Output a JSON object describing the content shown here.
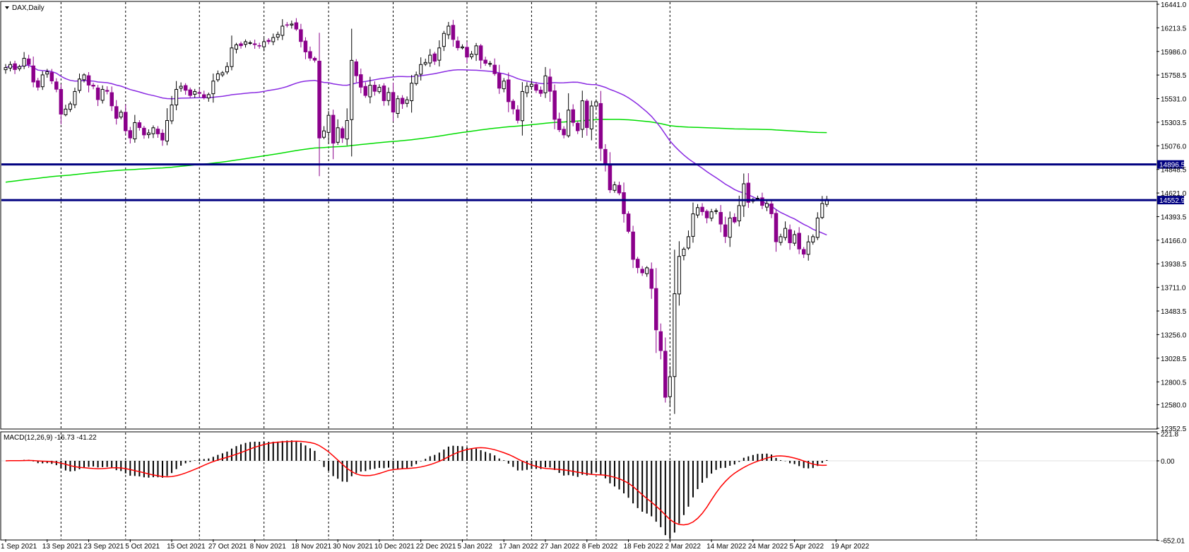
{
  "chart_title": "DAX,Daily",
  "chart_data": {
    "type": "candlestick",
    "symbol": "DAX",
    "timeframe": "Daily",
    "price_axis": {
      "ylim": [
        12352.5,
        16441.0
      ],
      "ticks": [
        "16441.0",
        "16213.5",
        "15986.0",
        "15758.5",
        "15531.0",
        "15303.5",
        "15076.0",
        "14848.5",
        "14621.0",
        "14393.5",
        "14166.0",
        "13938.5",
        "13711.0",
        "13483.5",
        "13256.0",
        "13028.5",
        "12800.5",
        "12580.0",
        "12352.5"
      ]
    },
    "x_axis": {
      "tick_labels": [
        "1 Sep 2021",
        "13 Sep 2021",
        "23 Sep 2021",
        "5 Oct 2021",
        "15 Oct 2021",
        "27 Oct 2021",
        "8 Nov 2021",
        "18 Nov 2021",
        "30 Nov 2021",
        "10 Dec 2021",
        "22 Dec 2021",
        "5 Jan 2022",
        "17 Jan 2022",
        "27 Jan 2022",
        "8 Feb 2022",
        "18 Feb 2022",
        "2 Mar 2022",
        "14 Mar 2022",
        "24 Mar 2022",
        "5 Apr 2022",
        "19 Apr 2022"
      ],
      "grid_at": [
        "13 Sep 2021",
        "5 Oct 2021",
        "27 Oct 2021",
        "18 Nov 2021",
        "10 Dec 2021",
        "5 Jan 2022",
        "27 Jan 2022",
        "18 Feb 2022",
        "14 Mar 2022",
        "5 Apr 2022"
      ]
    },
    "horizontal_levels": [
      {
        "price": 14896.5,
        "label": "14896.5",
        "color": "#000080"
      },
      {
        "price": 14552.9,
        "label": "14552.9",
        "color": "#000080"
      }
    ],
    "moving_averages": [
      {
        "role": "50-period",
        "color": "#8a2be2"
      },
      {
        "role": "200-period",
        "color": "#00dd00"
      }
    ],
    "close": [
      15830,
      15860,
      15810,
      15840,
      15920,
      15860,
      15690,
      15640,
      15760,
      15790,
      15700,
      15620,
      15380,
      15430,
      15480,
      15600,
      15720,
      15760,
      15660,
      15650,
      15520,
      15620,
      15600,
      15460,
      15340,
      15400,
      15220,
      15150,
      15300,
      15250,
      15180,
      15200,
      15250,
      15190,
      15130,
      15320,
      15470,
      15620,
      15650,
      15610,
      15560,
      15600,
      15580,
      15540,
      15570,
      15700,
      15770,
      15780,
      15840,
      16020,
      16050,
      16040,
      16080,
      16070,
      16050,
      16040,
      16080,
      16080,
      16120,
      16150,
      16230,
      16240,
      16250,
      16200,
      16080,
      15980,
      15920,
      15900,
      15150,
      15220,
      15370,
      15100,
      15250,
      15150,
      15320,
      15900,
      15750,
      15640,
      15560,
      15660,
      15600,
      15640,
      15510,
      15590,
      15400,
      15530,
      15480,
      15520,
      15680,
      15760,
      15860,
      15880,
      15950,
      15890,
      16020,
      16160,
      16230,
      16100,
      16020,
      16030,
      15930,
      15960,
      16040,
      15900,
      15870,
      15870,
      15770,
      15630,
      15700,
      15500,
      15430,
      15320,
      15600,
      15650,
      15670,
      15610,
      15580,
      15750,
      15600,
      15330,
      15230,
      15180,
      15420,
      15300,
      15220,
      15510,
      15250,
      15460,
      15500,
      15050,
      14900,
      14650,
      14700,
      14620,
      14420,
      14250,
      13980,
      13900,
      13850,
      13900,
      13700,
      13300,
      13100,
      12650,
      12850,
      13650,
      14010,
      14080,
      14200,
      14420,
      14480,
      14440,
      14380,
      14440,
      14450,
      14320,
      14200,
      14380,
      14340,
      14500,
      14710,
      14530,
      14560,
      14570,
      14500,
      14520,
      14420,
      14150,
      14200,
      14280,
      14140,
      14220,
      14080,
      14030,
      14150,
      14200,
      14380,
      14520,
      14560
    ]
  }
}
